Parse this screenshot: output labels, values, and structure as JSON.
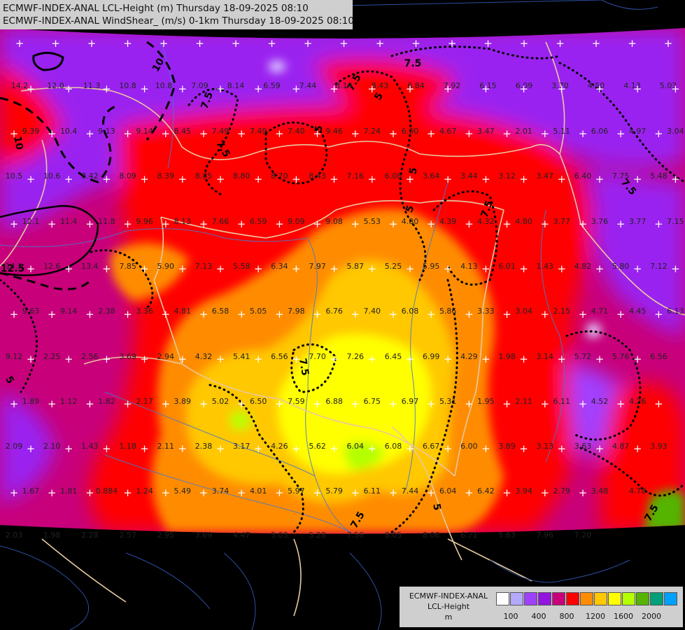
{
  "header": {
    "line1": "ECMWF-INDEX-ANAL LCL-Height (m) Thursday 18-09-2025 08:10",
    "line2": "ECMWF-INDEX-ANAL WindShear_ (m/s) 0-1km Thursday 18-09-2025 08:10"
  },
  "legend": {
    "line1": "ECMWF-INDEX-ANAL",
    "line2": "LCL-Height",
    "line3": "m",
    "colors": [
      "#ffffff",
      "#b4a9ff",
      "#a040ff",
      "#9414e0",
      "#c8007a",
      "#ff0000",
      "#ff8c00",
      "#ffc800",
      "#ffff00",
      "#b4ff00",
      "#54b400",
      "#00a078",
      "#00a0ff"
    ],
    "ticks": [
      "100",
      "400",
      "800",
      "1200",
      "1600",
      "2000"
    ]
  },
  "colors": {
    "background": "#000000",
    "purple": "#9a22f0",
    "magenta": "#c8007a",
    "red": "#ff0000",
    "orange": "#ff8c00",
    "amber": "#ffc800",
    "yellow": "#ffff00",
    "lime": "#b4ff00",
    "border": "#e8c8a0",
    "river": "#4a78c8"
  },
  "contour_labels": [
    "10",
    "7.5",
    "7.5",
    "7.5",
    "7.5",
    "5",
    "5",
    "5",
    "5",
    "7.5",
    "7.5",
    "7.5",
    "5",
    "7.5",
    "7.5",
    "12.5",
    "10",
    "5"
  ],
  "values": [
    [
      "14.2",
      "12.0",
      "11.3",
      "10.8",
      "10.8",
      "7.09",
      "8.14",
      "6.59",
      "7.44",
      "8.14",
      "8.43",
      "6.84",
      "7.92",
      "6.15",
      "6.09",
      "3.70",
      "4.50",
      "4.13",
      "5.03"
    ],
    [
      "9.39",
      "10.4",
      "9.13",
      "9.14",
      "8.45",
      "7.49",
      "7.49",
      "7.40",
      "9.46",
      "7.24",
      "6.00",
      "4.67",
      "3.47",
      "2.01",
      "5.11",
      "6.06",
      "4.97",
      "3.04"
    ],
    [
      "10.5",
      "10.6",
      "8.42",
      "8.09",
      "8.39",
      "8.85",
      "8.80",
      "8.70",
      "8.43",
      "7.16",
      "6.08",
      "3.64",
      "3.44",
      "3.12",
      "3.47",
      "6.40",
      "7.75",
      "5.48"
    ],
    [
      "12.1",
      "11.4",
      "11.8",
      "9.96",
      "8.13",
      "7.66",
      "6.59",
      "9.09",
      "9.08",
      "5.53",
      "4.80",
      "4.39",
      "4.32",
      "4.80",
      "3.77",
      "3.76",
      "3.77",
      "7.15"
    ],
    [
      "14.2",
      "12.6",
      "13.4",
      "7.85",
      "5.90",
      "7.13",
      "5.58",
      "6.34",
      "7.97",
      "5.87",
      "5.25",
      "5.95",
      "4.13",
      "6.01",
      "1.43",
      "4.82",
      "5.80",
      "7.12"
    ],
    [
      "9.63",
      "9.14",
      "2.38",
      "3.36",
      "4.81",
      "6.58",
      "5.05",
      "7.98",
      "6.76",
      "7.40",
      "6.08",
      "5.86",
      "3.33",
      "3.04",
      "2.15",
      "4.71",
      "4.45",
      "6.13"
    ],
    [
      "9.12",
      "2.25",
      "2.56",
      "3.69",
      "2.94",
      "4.32",
      "5.41",
      "6.56",
      "7.70",
      "7.26",
      "6.45",
      "6.99",
      "4.29",
      "1.98",
      "3.14",
      "5.72",
      "5.76",
      "6.56"
    ],
    [
      "1.89",
      "1.12",
      "1.82",
      "2.17",
      "3.89",
      "5.02",
      "6.50",
      "7.59",
      "6.88",
      "6.75",
      "6.97",
      "5.31",
      "1.95",
      "2.11",
      "6.11",
      "4.52",
      "4.26"
    ],
    [
      "2.09",
      "2.10",
      "1.43",
      "1.18",
      "2.11",
      "2.38",
      "3.17",
      "4.26",
      "5.62",
      "6.04",
      "6.08",
      "6.67",
      "6.00",
      "3.89",
      "3.13",
      "3.63",
      "4.87",
      "3.93"
    ],
    [
      "1.67",
      "1.81",
      "0.884",
      "1.24",
      "5.49",
      "3.74",
      "4.01",
      "5.97",
      "5.79",
      "6.11",
      "7.44",
      "6.04",
      "6.42",
      "3.94",
      "2.79",
      "3.48",
      "4.78"
    ],
    [
      "2.03",
      "1.98",
      "2.28",
      "2.57",
      "2.95",
      "3.69",
      "4.47",
      "5.03",
      "5.28",
      "7.56",
      "8.05",
      "8.06",
      "6.71",
      "5.63",
      "7.96",
      "7.20"
    ]
  ]
}
